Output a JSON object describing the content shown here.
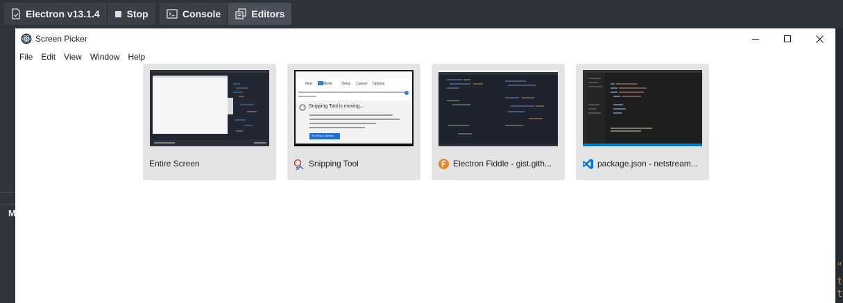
{
  "toolbar": {
    "version_label": "Electron v13.1.4",
    "stop_label": "Stop",
    "console_label": "Console",
    "editors_label": "Editors"
  },
  "background": {
    "sidebar_letter": "M",
    "code_fragments": [
      "\"",
      "t",
      "t"
    ]
  },
  "window": {
    "title": "Screen Picker",
    "menu": [
      "File",
      "Edit",
      "View",
      "Window",
      "Help"
    ]
  },
  "sources": [
    {
      "label": "Entire Screen",
      "icon": "none"
    },
    {
      "label": "Snipping Tool",
      "icon": "snipping-tool-icon"
    },
    {
      "label": "Electron Fiddle - gist.gith...",
      "icon": "electron-fiddle-icon"
    },
    {
      "label": "package.json - netstream...",
      "icon": "vscode-icon"
    }
  ],
  "snipping_preview": {
    "toolbar_items": [
      "New",
      "Mode",
      "Delay",
      "Cancel",
      "Options"
    ],
    "message_title": "Snipping Tool is moving...",
    "button_label": "Try Snip & Sketch"
  },
  "colors": {
    "toolbar_bg": "#2f333b",
    "button_bg": "#3a3f48",
    "card_bg": "#e4e4e4",
    "dark_thumb": "#1f2430",
    "vscode_blue": "#0078d4",
    "fiddle_orange": "#e5862b"
  }
}
